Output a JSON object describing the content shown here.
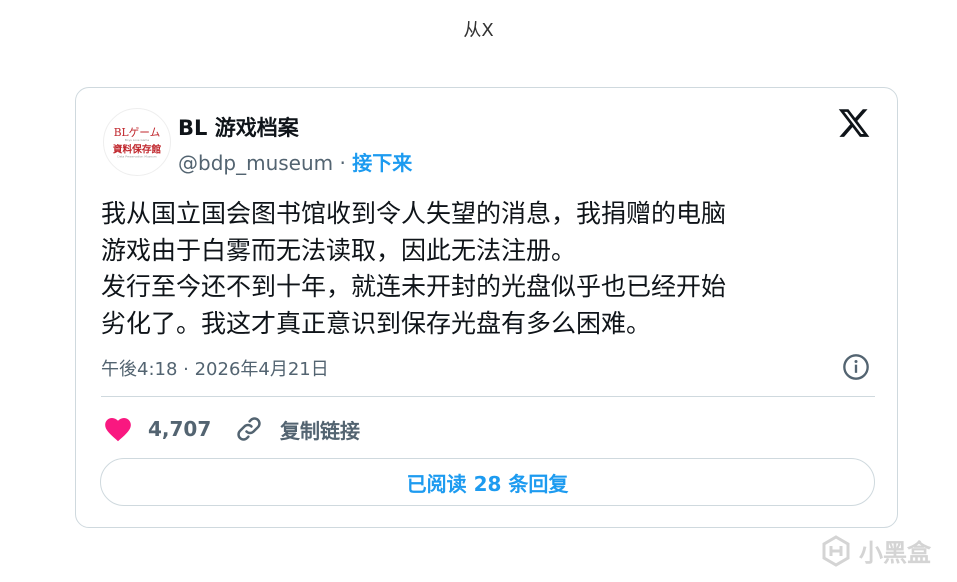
{
  "source_caption": "从X",
  "tweet": {
    "avatar_text_line1": "BLゲーム",
    "avatar_text_line2": "資料保存館",
    "display_name": "BL 游戏档案",
    "handle": "@bdp_museum",
    "separator": " · ",
    "follow_label": "接下来",
    "text_lines": [
      "我从国立国会图书馆收到令人失望的消息，我捐赠的电脑",
      "游戏由于白雾而无法读取，因此无法注册。",
      "发行至今还不到十年，就连未开封的光盘似乎也已经开始",
      "劣化了。我这才真正意识到保存光盘有多么困难。"
    ],
    "timestamp": "午後4:18 · 2026年4月21日",
    "like_count": "4,707",
    "copy_link_label": "复制链接",
    "replies_label": "已阅读 28 条回复"
  },
  "watermark_text": "小黑盒",
  "colors": {
    "accent": "#1d9bf0",
    "heart": "#f91880",
    "muted": "#536471",
    "border": "#cfd9de",
    "avatar_red": "#c0272d"
  },
  "icons": {
    "x_logo": "x-logo-icon",
    "info": "info-icon",
    "heart": "heart-icon",
    "link": "link-icon",
    "watermark_logo": "heybox-logo-icon"
  }
}
